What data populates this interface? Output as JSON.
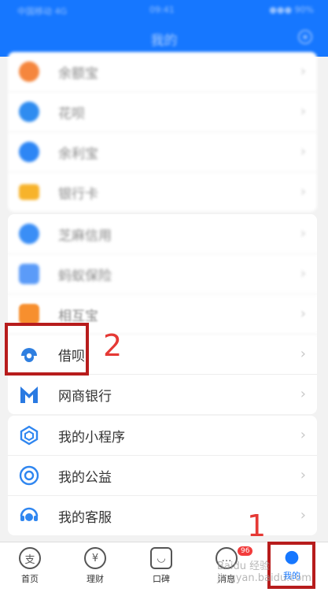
{
  "status_bar": {
    "carrier": "中国移动 4G",
    "time": "09:41",
    "battery": "●●● 90%"
  },
  "header": {
    "title": "我的"
  },
  "colors": {
    "accent": "#1677ff",
    "annotation_red": "#e53935"
  },
  "group1": [
    {
      "label": "余额宝",
      "icon": "yuebao-icon",
      "color": "#f5863d"
    },
    {
      "label": "花呗",
      "icon": "huabei-icon",
      "color": "#2f8cf0"
    },
    {
      "label": "余利宝",
      "icon": "yulibao-icon",
      "color": "#2d86f5"
    },
    {
      "label": "银行卡",
      "icon": "bank-card-icon",
      "color": "#f7b32b"
    }
  ],
  "group2": [
    {
      "label": "芝麻信用",
      "icon": "sesame-credit-icon",
      "color": "#3a8ef6"
    },
    {
      "label": "蚂蚁保险",
      "icon": "ant-insurance-icon",
      "color": "#5b9bf8"
    },
    {
      "label": "相互宝",
      "icon": "xianghubao-icon",
      "color": "#f78f2e"
    },
    {
      "label": "借呗",
      "icon": "jiebei-icon",
      "color": "#2f7fe0"
    },
    {
      "label": "网商银行",
      "icon": "mybank-icon",
      "color": "#2a7ae2"
    }
  ],
  "group3": [
    {
      "label": "我的小程序",
      "icon": "mini-program-icon",
      "color": "#2f86f0"
    },
    {
      "label": "我的公益",
      "icon": "charity-icon",
      "color": "#2f86f0"
    },
    {
      "label": "我的客服",
      "icon": "customer-service-icon",
      "color": "#2f86f0"
    }
  ],
  "annotations": {
    "step1": "1",
    "step2": "2"
  },
  "tabbar": [
    {
      "label": "首页",
      "glyph": "支"
    },
    {
      "label": "理财",
      "glyph": "¥"
    },
    {
      "label": "口碑",
      "glyph": "◡"
    },
    {
      "label": "消息",
      "glyph": "…",
      "badge": "96"
    },
    {
      "label": "我的",
      "glyph": "●"
    }
  ],
  "watermark": "Baidu 经验 jingyan.baidu.com"
}
